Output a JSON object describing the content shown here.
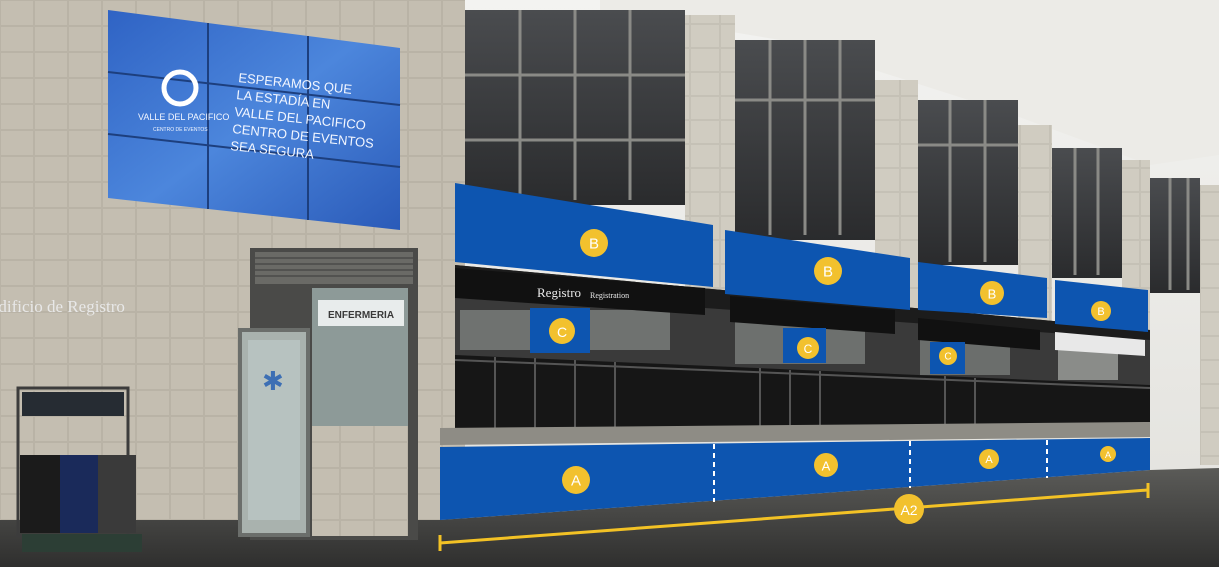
{
  "screen": {
    "brand_name": "VALLE DEL PACIFICO",
    "brand_sub": "CENTRO DE EVENTOS",
    "lines": [
      "ESPERAMOS QUE",
      "LA ESTADÍA EN",
      "VALLE DEL PACIFICO",
      "CENTRO DE EVENTOS",
      "SEA SEGURA"
    ]
  },
  "wall_sign": "Edificio de Registro",
  "nurse_sign": "ENFERMERIA",
  "counter_sign": "Registro",
  "counter_sign_sub": "Registration",
  "zones": {
    "a_label": "A",
    "b_label": "B",
    "c_label": "C",
    "a2_label": "A2"
  },
  "colors": {
    "banner_blue": "#0d55b0",
    "badge_yellow": "#f2c12e",
    "measure_yellow": "#f3c225"
  }
}
